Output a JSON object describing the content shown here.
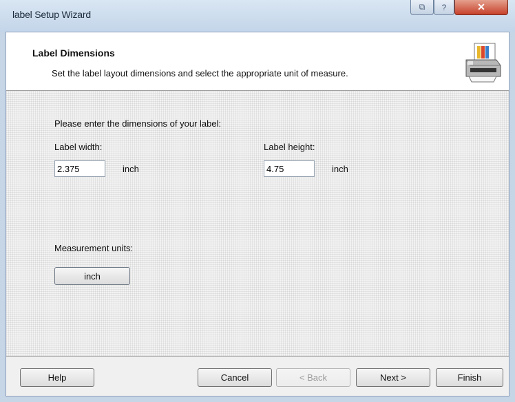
{
  "window": {
    "title": "label Setup Wizard",
    "restore_label": "⧉",
    "help_label": "?",
    "close_label": "✕"
  },
  "header": {
    "title": "Label Dimensions",
    "subtitle": "Set the label layout dimensions and select the appropriate unit of measure."
  },
  "form": {
    "prompt": "Please enter the dimensions of your label:",
    "width_label": "Label width:",
    "width_value": "2.375",
    "width_unit": "inch",
    "height_label": "Label height:",
    "height_value": "4.75",
    "height_unit": "inch",
    "units_label": "Measurement units:",
    "units_button": "inch"
  },
  "buttons": {
    "help": "Help",
    "cancel": "Cancel",
    "back": "< Back",
    "next": "Next >",
    "finish": "Finish"
  }
}
